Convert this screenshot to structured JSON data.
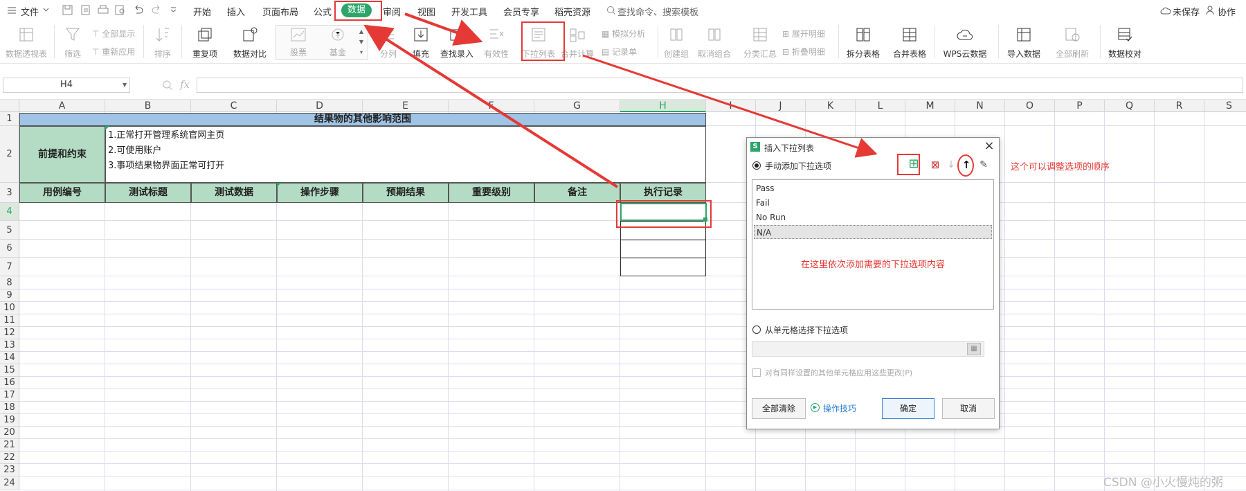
{
  "menu": {
    "file": "文件",
    "tabs": [
      "开始",
      "插入",
      "页面布局",
      "公式",
      "数据",
      "审阅",
      "视图",
      "开发工具",
      "会员专享",
      "稻壳资源"
    ],
    "active_tab": "数据",
    "search": "查找命令、搜索模板",
    "unsaved": "未保存",
    "collab": "协作"
  },
  "ribbon": {
    "pivot": "数据透视表",
    "filter": "筛选",
    "show_all": "全部显示",
    "reapply": "重新应用",
    "sort": "排序",
    "duplicates": "重复项",
    "compare": "数据对比",
    "stock": "股票",
    "fund": "基金",
    "split": "分列",
    "fill": "填充",
    "lookup_entry": "查找录入",
    "validity": "有效性",
    "dropdown_list": "下拉列表",
    "merge_calc": "合并计算",
    "simulate": "模拟分析",
    "record": "记录单",
    "group": "创建组",
    "ungroup": "取消组合",
    "subtotal": "分类汇总",
    "expand": "展开明细",
    "collapse": "折叠明细",
    "split_table": "拆分表格",
    "merge_table": "合并表格",
    "wps_cloud": "WPS云数据",
    "import": "导入数据",
    "refresh_all": "全部刷新",
    "proof": "数据校对"
  },
  "formula_bar": {
    "cell_ref": "H4",
    "fx": "fx",
    "value": ""
  },
  "columns": [
    "A",
    "B",
    "C",
    "D",
    "E",
    "F",
    "G",
    "H",
    "I",
    "J",
    "K",
    "L",
    "M",
    "N",
    "O",
    "P",
    "Q",
    "R",
    "S"
  ],
  "rows": [
    "1",
    "2",
    "3",
    "4",
    "5",
    "6",
    "7",
    "8",
    "9",
    "10",
    "11",
    "12",
    "13",
    "14",
    "15",
    "16",
    "17",
    "18",
    "19",
    "20",
    "21",
    "22",
    "23",
    "24"
  ],
  "sheet": {
    "title": "结果物的其他影响范围",
    "precondition_label": "前提和约束",
    "preconditions": [
      "1.正常打开管理系统官网主页",
      "2.可使用账户",
      "3.事项结果物界面正常可打开"
    ],
    "headers": [
      "用例编号",
      "测试标题",
      "测试数据",
      "操作步骤",
      "预期结果",
      "重要级别",
      "备注",
      "执行记录"
    ]
  },
  "dialog": {
    "title": "插入下拉列表",
    "manual_option": "手动添加下拉选项",
    "items": [
      "Pass",
      "Fail",
      "No Run",
      "N/A"
    ],
    "selected_item": "N/A",
    "hint": "在这里依次添加需要的下拉选项内容",
    "cell_option": "从单元格选择下拉选项",
    "apply_label": "对有同样设置的其他单元格应用这些更改(P)",
    "clear_all": "全部清除",
    "tips": "操作技巧",
    "ok": "确定",
    "cancel": "取消"
  },
  "annotation": {
    "reorder_note": "这个可以调整选项的顺序"
  },
  "watermark": "CSDN @小火慢炖的粥",
  "colors": {
    "accent": "#2ca569",
    "header_fill": "#b4dcc4",
    "title_fill": "#9fc4e6",
    "annotation_red": "#e53935"
  }
}
